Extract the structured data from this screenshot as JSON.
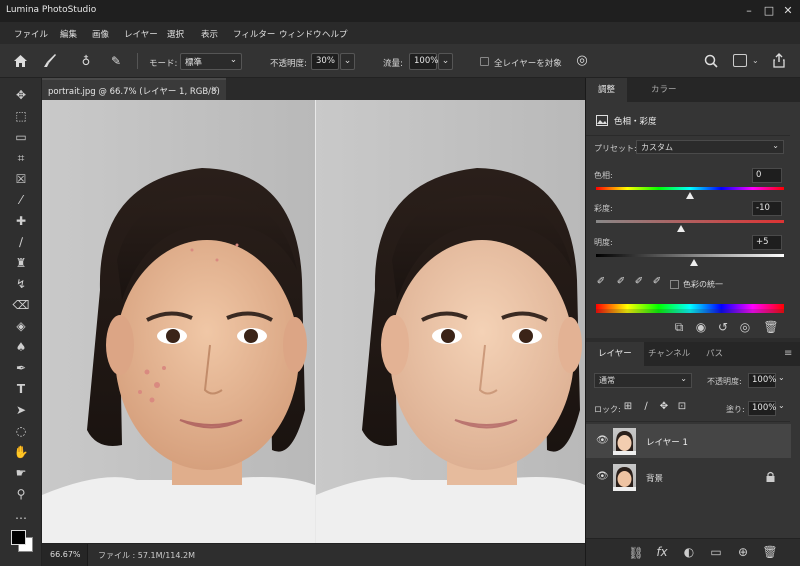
{
  "app": {
    "title": "Lumina PhotoStudio"
  },
  "window_controls": {
    "minimize": "–",
    "maximize": "□",
    "close": "✕"
  },
  "menu": [
    "ファイル",
    "編集",
    "画像",
    "レイヤー",
    "選択",
    "表示",
    "フィルター",
    "ウィンドウ",
    "ヘルプ"
  ],
  "options": {
    "mode_label": "モード:",
    "mode_value": "標準",
    "opacity_label": "不透明度:",
    "opacity_value": "30%",
    "flow_label": "流量:",
    "flow_value": "100%",
    "all_layers_label": "全レイヤーを対象"
  },
  "document": {
    "tab_title": "portrait.jpg @ 66.7% (レイヤー 1, RGB/8)",
    "tab_close": "✕",
    "zoom": "66.67%",
    "file_size": "ファイル : 57.1M/114.2M"
  },
  "adjust_panel": {
    "tabs": [
      "調整",
      "カラー"
    ],
    "title": "色相・彩度",
    "preset_label": "プリセット:",
    "preset_value": "カスタム",
    "hue_label": "色相:",
    "hue_value": "0",
    "hue_fraction": 0.5,
    "saturation_label": "彩度:",
    "saturation_value": "-10",
    "saturation_fraction": 0.45,
    "lightness_label": "明度:",
    "lightness_value": "+5",
    "lightness_fraction": 0.52,
    "colorize_label": "色彩の統一"
  },
  "layers_panel": {
    "tabs": [
      "レイヤー",
      "チャンネル",
      "パス"
    ],
    "blend_value": "通常",
    "opacity_label": "不透明度:",
    "opacity_value": "100%",
    "lock_label": "ロック:",
    "fill_label": "塗り:",
    "fill_value": "100%",
    "layers": [
      {
        "name": "レイヤー 1",
        "selected": true,
        "locked": false
      },
      {
        "name": "背景",
        "selected": false,
        "locked": true
      }
    ]
  },
  "colors": {
    "accent": "#4a90d9",
    "selected_layer": "#404040",
    "panel_bg": "#2c2c2c"
  }
}
